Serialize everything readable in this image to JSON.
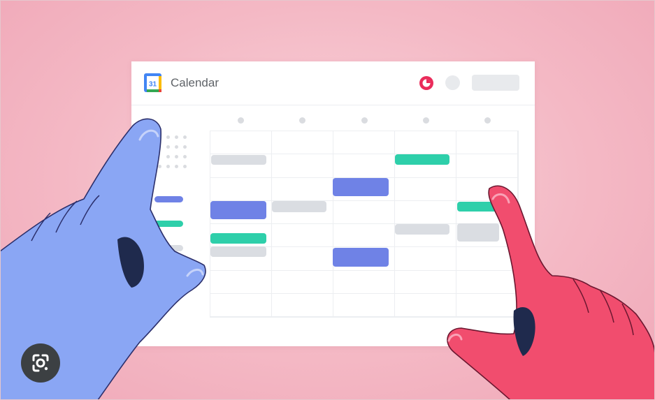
{
  "app": {
    "title": "Calendar",
    "logo_day": "31"
  },
  "colors": {
    "background": "#f4b9c5",
    "card": "#ffffff",
    "event_blue": "#6f82e6",
    "event_teal": "#2ecfaa",
    "event_gray": "#dadde2",
    "hand_left": "#8aa6f4",
    "hand_right": "#f14d6e",
    "accent_red": "#ea2c5b"
  },
  "icons": {
    "logo": "google-calendar-logo-icon",
    "user_avatar": "clock-avatar-icon",
    "lens": "google-lens-icon"
  }
}
